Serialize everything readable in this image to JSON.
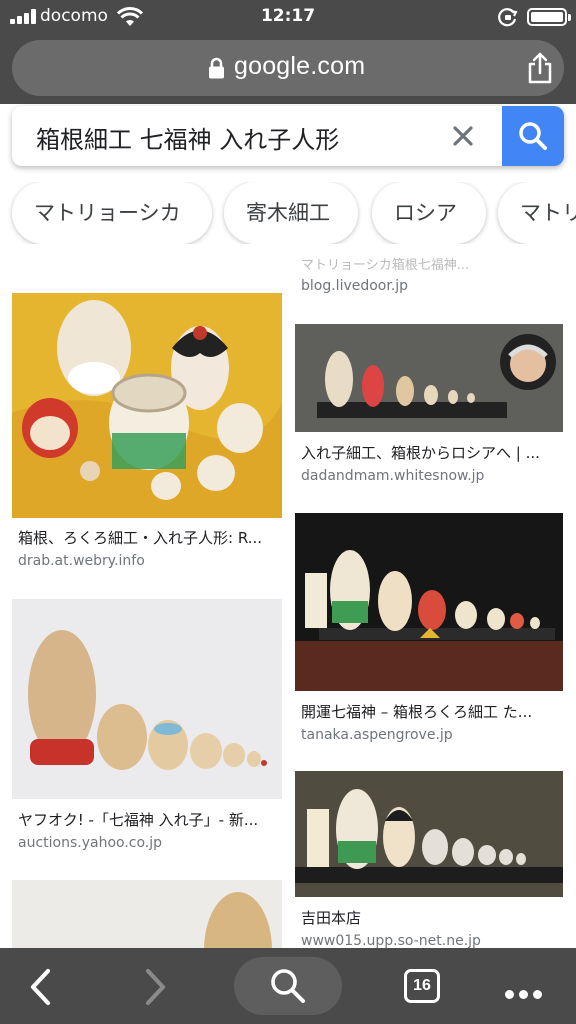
{
  "status_bar": {
    "carrier": "docomo",
    "time": "12:17"
  },
  "browser": {
    "url": "google.com"
  },
  "search": {
    "query": "箱根細工 七福神 入れ子人形"
  },
  "chips": [
    "マトリョーシカ",
    "寄木細工",
    "ロシア",
    "マトリ"
  ],
  "results": {
    "faded_top_text": "マトリョーシカ箱根七福神...",
    "faded_top_source": "blog.livedoor.jp",
    "left": [
      {
        "title": "箱根、ろくろ細工・入れ子人形: R...",
        "source": "drab.at.webry.info"
      },
      {
        "title": "ヤフオク! -「七福神 入れ子」- 新...",
        "source": "auctions.yahoo.co.jp"
      },
      {
        "title": "",
        "source": ""
      }
    ],
    "right": [
      {
        "title": "入れ子細工、箱根からロシアへ | ...",
        "source": "dadandmam.whitesnow.jp"
      },
      {
        "title": "開運七福神 – 箱根ろくろ細工 た...",
        "source": "tanaka.aspengrove.jp"
      },
      {
        "title": "吉田本店",
        "source": "www015.upp.so-net.ne.jp"
      }
    ]
  },
  "toolbar": {
    "tab_count": "16"
  },
  "colors": {
    "chrome": "#4a4a4a",
    "search_button": "#4285f4",
    "source_text": "#70757a"
  }
}
